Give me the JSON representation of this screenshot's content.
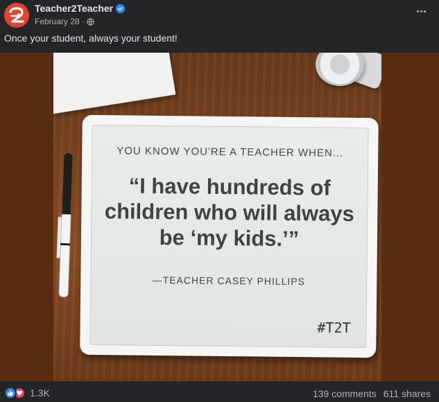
{
  "post": {
    "page_name": "Teacher2Teacher",
    "date": "February 28",
    "separator": "·",
    "privacy_icon": "globe-icon",
    "more_icon": "more-options-icon",
    "caption": "Once your student, always your student!"
  },
  "image": {
    "board_header": "YOU KNOW YOU'RE A TEACHER WHEN...",
    "board_quote": "“I have hundreds of children who will always be ‘my kids.’”",
    "board_attribution": "—TEACHER CASEY PHILLIPS",
    "board_hashtag": "#T2T"
  },
  "footer": {
    "reaction_icons": [
      "like-icon",
      "love-icon"
    ],
    "reaction_count": "1.3K",
    "comments": "139 comments",
    "shares": "611 shares"
  },
  "colors": {
    "background": "#242526",
    "brand": "#e34432",
    "verified": "#2d88ff",
    "like": "#2d88ff",
    "love": "#f33e58",
    "primary_text": "#e4e6eb",
    "secondary_text": "#b0b3b8"
  }
}
